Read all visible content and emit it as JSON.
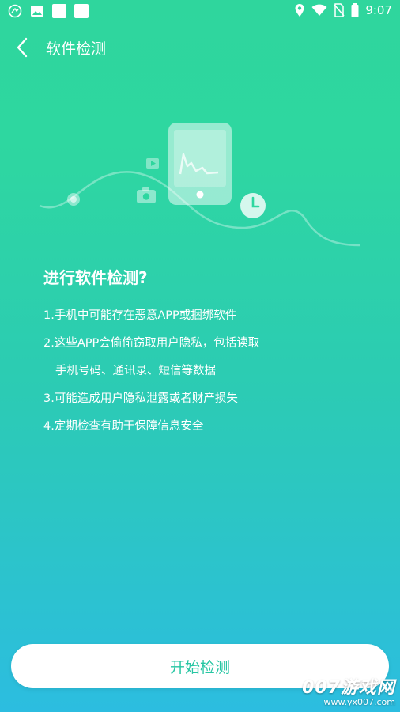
{
  "status_bar": {
    "time": "9:07",
    "left_icons": [
      "notification-app-icon",
      "image-icon",
      "notification-box-icon",
      "notification-box-icon"
    ],
    "right_icons": [
      "location-icon",
      "wifi-icon",
      "no-sim-icon",
      "battery-icon"
    ]
  },
  "header": {
    "title": "软件检测",
    "back_icon": "chevron-left-icon"
  },
  "illustration": {
    "icons": [
      "phone-icon",
      "play-icon",
      "camera-icon",
      "clock-icon"
    ]
  },
  "content": {
    "heading": "进行软件检测?",
    "lines": [
      "1.手机中可能存在恶意APP或捆绑软件",
      "2.这些APP会偷偷窃取用户隐私，包括读取",
      "手机号码、通讯录、短信等数据",
      "3.可能造成用户隐私泄露或者财产损失",
      "4.定期检查有助于保障信息安全"
    ]
  },
  "action": {
    "start_label": "开始检测"
  },
  "watermark": {
    "logo": "007游戏网",
    "url": "www.yx007.com"
  },
  "colors": {
    "gradient_top": "#2fd69d",
    "gradient_bottom": "#2cbde0",
    "button_text": "#27c6a3"
  }
}
